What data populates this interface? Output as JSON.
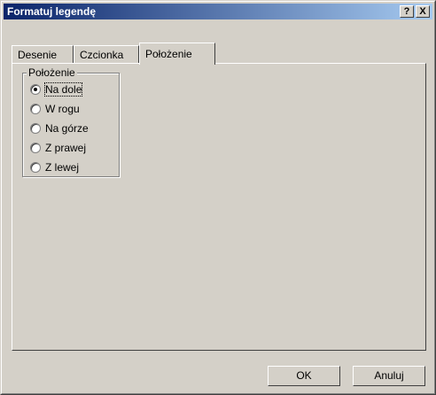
{
  "window": {
    "title": "Formatuj legendę",
    "help_label": "?",
    "close_label": "X"
  },
  "tabs": [
    {
      "label": "Desenie"
    },
    {
      "label": "Czcionka"
    },
    {
      "label": "Położenie"
    }
  ],
  "placement_group": {
    "label": "Położenie",
    "options": [
      {
        "label": "Na dole",
        "selected": true
      },
      {
        "label": "W rogu",
        "selected": false
      },
      {
        "label": "Na górze",
        "selected": false
      },
      {
        "label": "Z prawej",
        "selected": false
      },
      {
        "label": "Z lewej",
        "selected": false
      }
    ]
  },
  "buttons": {
    "ok_label": "OK",
    "cancel_label": "Anuluj"
  }
}
